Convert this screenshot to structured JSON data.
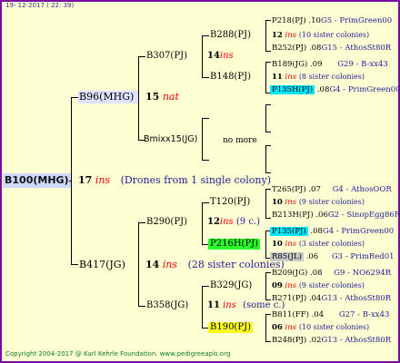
{
  "header": {
    "date": "19- 12-2017 ( 22: 39)"
  },
  "footer": {
    "copyright": "Copyright 2004-2017 @ Karl Kehrle Foundation.   www.pedigreeapis.org"
  },
  "root": {
    "label": "B100(MHG)",
    "num": "17",
    "ins": "ins",
    "note": "(Drones from 1 single colony)"
  },
  "b96": {
    "label": "B96(MHG)",
    "num": "15",
    "ins": "nat"
  },
  "b417": {
    "label": "B417(JG)",
    "num": "14",
    "ins": "ins",
    "note": "(28 sister colonies)"
  },
  "b307": {
    "label": "B307(PJ)",
    "num": "14",
    "ins": "ins"
  },
  "bmixx": {
    "label": "Bmixx15(JG)",
    "note": "no more"
  },
  "b290": {
    "label": "B290(PJ)",
    "num": "12",
    "ins": "ins",
    "note": "(9 c.)"
  },
  "b358": {
    "label": "B358(JG)",
    "num": "11",
    "ins": "ins",
    "note": "(some c.)"
  },
  "b288": {
    "label": "B288(PJ)"
  },
  "b148": {
    "label": "B148(PJ)"
  },
  "t120": {
    "label": "T120(PJ)"
  },
  "p216": {
    "label": "P216H(PJ)"
  },
  "b329": {
    "label": "B329(JG)"
  },
  "b190": {
    "label": "B190(PJ)"
  },
  "gen4": [
    {
      "name": "P218(PJ)",
      "mid": ".10",
      "info": "G5 - PrimGreen00"
    },
    {
      "num": "12",
      "ins": "ins",
      "note": "(10 sister colonies)"
    },
    {
      "name": "B252(PJ)",
      "mid": ".08",
      "info": "G15 - AthosSt80R"
    },
    {
      "name": "B189(JG)",
      "mid": ".09",
      "info": "G29 - B-xx43"
    },
    {
      "num": "11",
      "ins": "ins",
      "note": "(8 sister colonies)"
    },
    {
      "name": "P135H(PJ)",
      "mid": ".08",
      "info": "G4 - PrimGreen00"
    },
    {
      "name": "T265(PJ)",
      "mid": ".07",
      "info": "G4 - AthosOOR"
    },
    {
      "num": "10",
      "ins": "ins",
      "note": "(9 sister colonies)"
    },
    {
      "name": "B213H(PJ)",
      "mid": ".06",
      "info": "G2 - SinopEgg86R"
    },
    {
      "name": "P135(PJ)",
      "mid": ".08",
      "info": "G4 - PrimGreen00"
    },
    {
      "num": "10",
      "ins": "ins",
      "note": "(3 sister colonies)"
    },
    {
      "name": "R85(JL)",
      "mid": ".06",
      "info": "G3 - PrimRed01"
    },
    {
      "name": "B209(JG)",
      "mid": ".08",
      "info": "G9 - NO6294R"
    },
    {
      "num": "09",
      "ins": "ins",
      "note": "(9 sister colonies)"
    },
    {
      "name": "B271(PJ)",
      "mid": ".04",
      "info": "G13 - AthosSt80R"
    },
    {
      "name": "B811(FF)",
      "mid": ".04",
      "info": "G27 - B-xx43"
    },
    {
      "num": "06",
      "ins": "ins",
      "note": "(10 sister colonies)"
    },
    {
      "name": "B248(PJ)",
      "mid": ".02",
      "info": "G13 - AthosSt80R"
    }
  ]
}
